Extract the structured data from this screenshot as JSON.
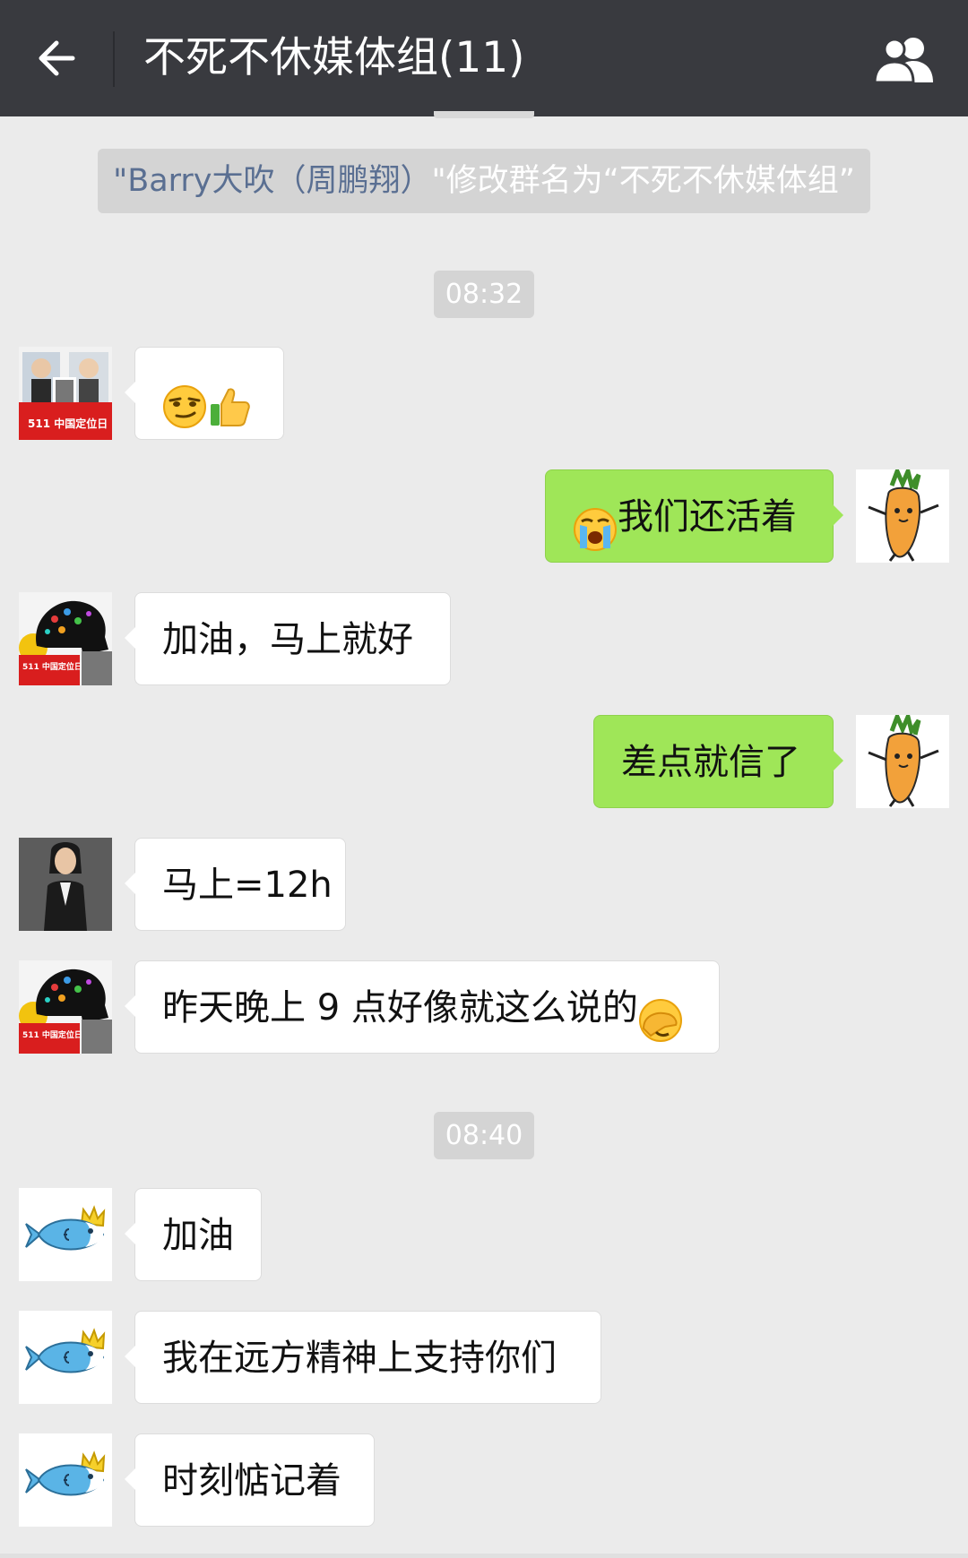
{
  "header": {
    "title": "不死不休媒体组(11)",
    "back_icon": "back-arrow-icon",
    "members_icon": "group-members-icon",
    "bg_color": "#393a3f"
  },
  "system_notice": {
    "prefix_quote": "\"",
    "name": "Barry大吹（周鹏翔）",
    "rest": "\"修改群名为“不死不休媒体组”"
  },
  "timestamps": [
    "08:32",
    "08:40"
  ],
  "messages": [
    {
      "side": "left",
      "avatar": "avatar-511-poster-two-men",
      "text": "",
      "emojis": [
        "smirk-emoji-icon",
        "thumbs-up-icon"
      ]
    },
    {
      "side": "right",
      "avatar": "avatar-carrot",
      "text": "我们还活着",
      "emojis": [
        "crying-emoji-icon"
      ]
    },
    {
      "side": "left",
      "avatar": "avatar-511-brain-poster",
      "text": "加油，马上就好",
      "emojis": []
    },
    {
      "side": "right",
      "avatar": "avatar-carrot",
      "text": "差点就信了",
      "emojis": []
    },
    {
      "side": "left",
      "avatar": "avatar-woman-portrait",
      "text": "马上=12h",
      "emojis": []
    },
    {
      "side": "left",
      "avatar": "avatar-511-brain-poster",
      "text": "昨天晚上 9 点好像就这么说的",
      "emojis": [
        "facepalm-emoji-icon"
      ]
    },
    {
      "side": "left",
      "avatar": "avatar-crowned-fish",
      "text": "加油",
      "emojis": []
    },
    {
      "side": "left",
      "avatar": "avatar-crowned-fish",
      "text": "我在远方精神上支持你们",
      "emojis": []
    },
    {
      "side": "left",
      "avatar": "avatar-crowned-fish",
      "text": "时刻惦记着",
      "emojis": []
    }
  ],
  "colors": {
    "chat_bg": "#ebebeb",
    "my_bubble": "#9fe658",
    "other_bubble": "#ffffff",
    "notice_name": "#5a6f92"
  },
  "avatar_poster_text": "511 中国定位日"
}
